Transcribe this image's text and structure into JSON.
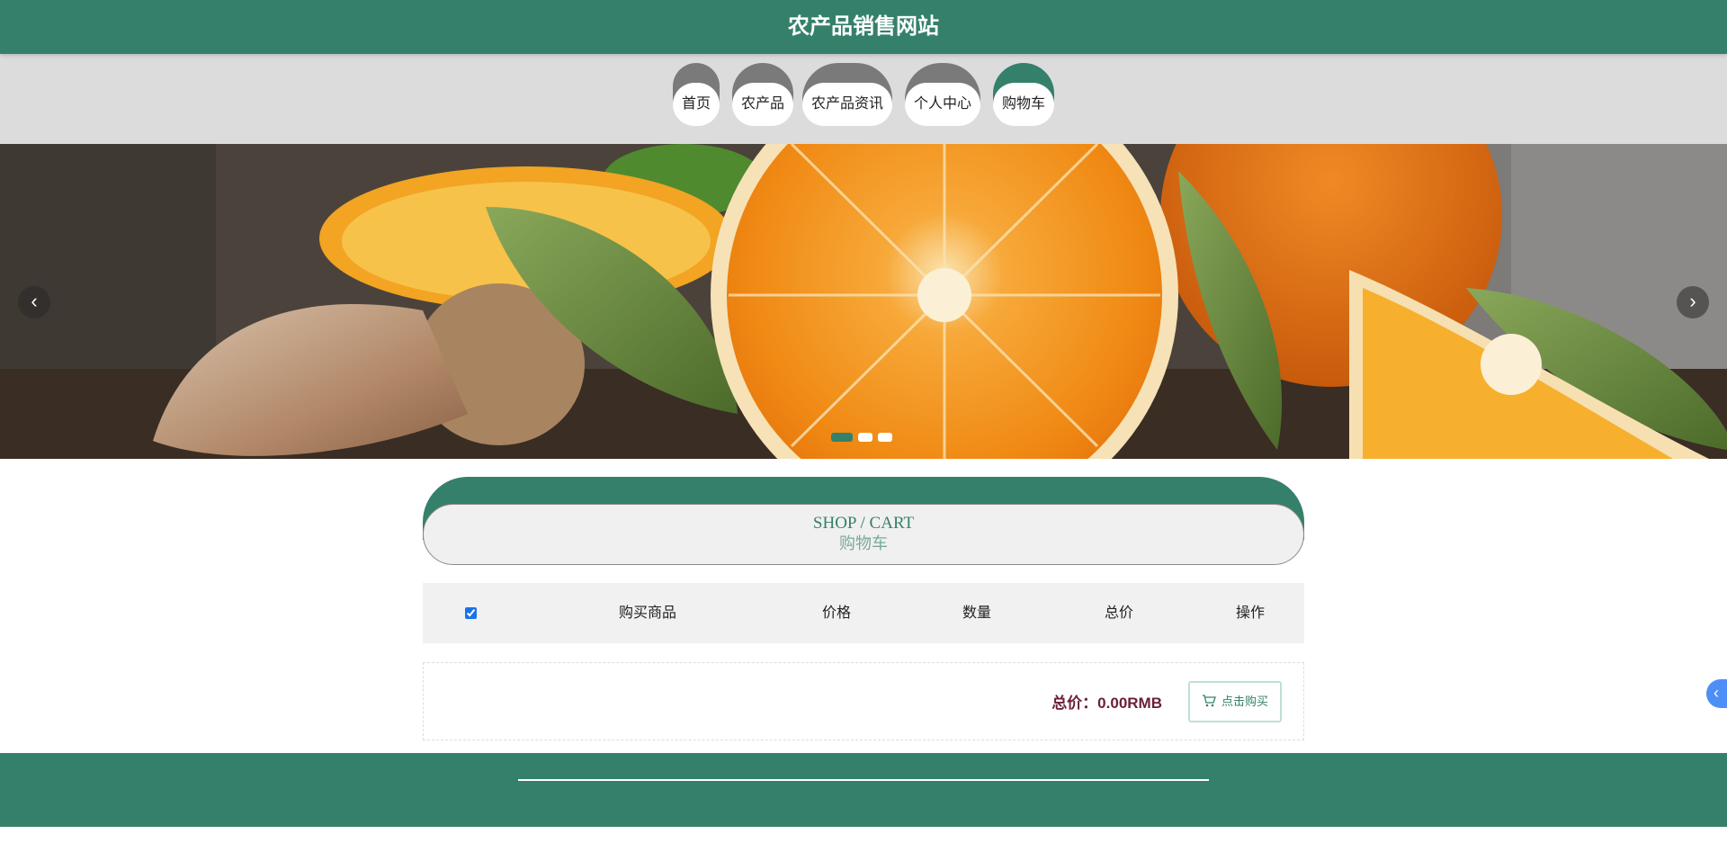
{
  "header": {
    "title": "农产品销售网站"
  },
  "nav": {
    "items": [
      {
        "label": "首页"
      },
      {
        "label": "农产品"
      },
      {
        "label": "农产品资讯"
      },
      {
        "label": "个人中心"
      },
      {
        "label": "购物车"
      }
    ],
    "active_index": 4
  },
  "banner": {
    "prev_icon": "chevron-left-icon",
    "next_icon": "chevron-right-icon",
    "slide_count": 3,
    "active_slide": 0
  },
  "section": {
    "title_en": "SHOP / CART",
    "title_cn": "购物车"
  },
  "cart": {
    "select_all_checked": true,
    "columns": [
      "购买商品",
      "价格",
      "数量",
      "总价",
      "操作"
    ]
  },
  "summary": {
    "total_text": "总价：0.00RMB",
    "buy_label": "点击购买",
    "buy_icon": "cart-icon"
  },
  "colors": {
    "brand": "#35806b",
    "nav_inactive": "#7a7a7a",
    "total_text": "#6b1f3a",
    "side_tab": "#4e8ef7"
  }
}
